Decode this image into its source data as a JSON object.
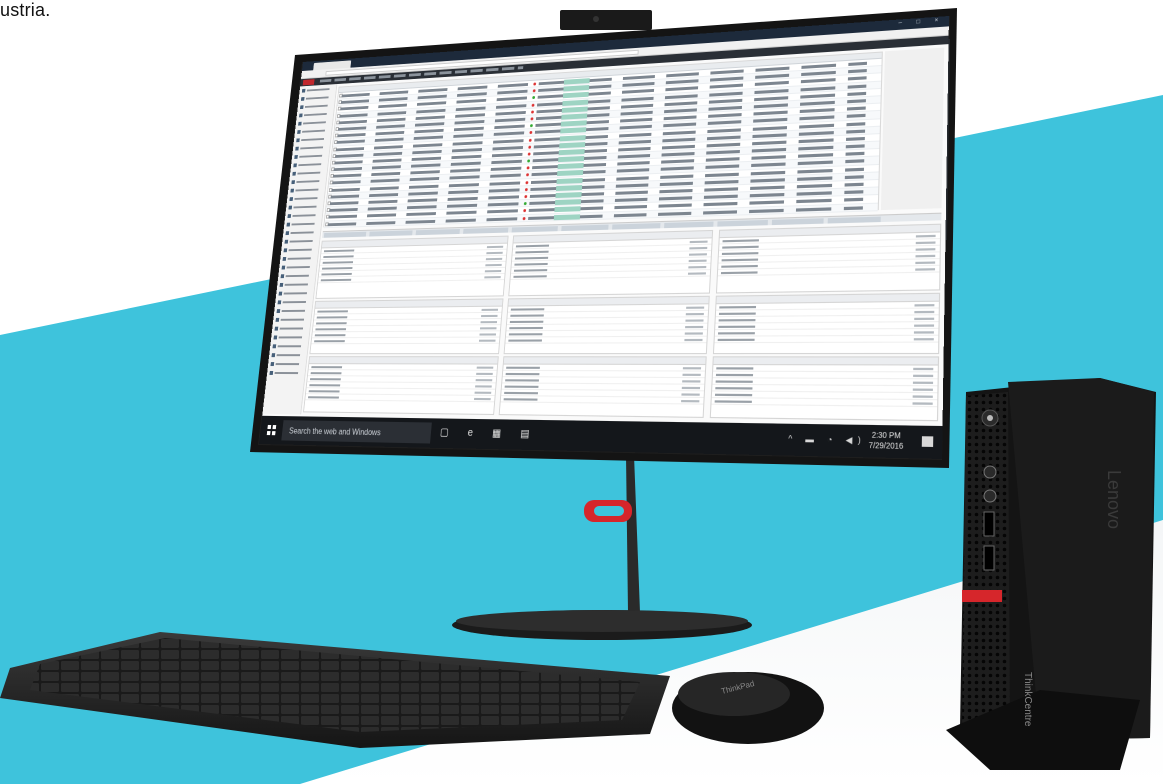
{
  "caption": "ustria.",
  "screen": {
    "taskbar": {
      "search_placeholder": "Search the web and Windows",
      "time": "2:30 PM",
      "date": "7/29/2016"
    }
  },
  "hardware": {
    "pc_brand": "Lenovo",
    "pc_model": "ThinkCentre",
    "mouse_brand": "ThinkPad"
  },
  "colors": {
    "background_blue": "#3ec3dc",
    "accent_red": "#d6262b",
    "device_black": "#161616"
  }
}
